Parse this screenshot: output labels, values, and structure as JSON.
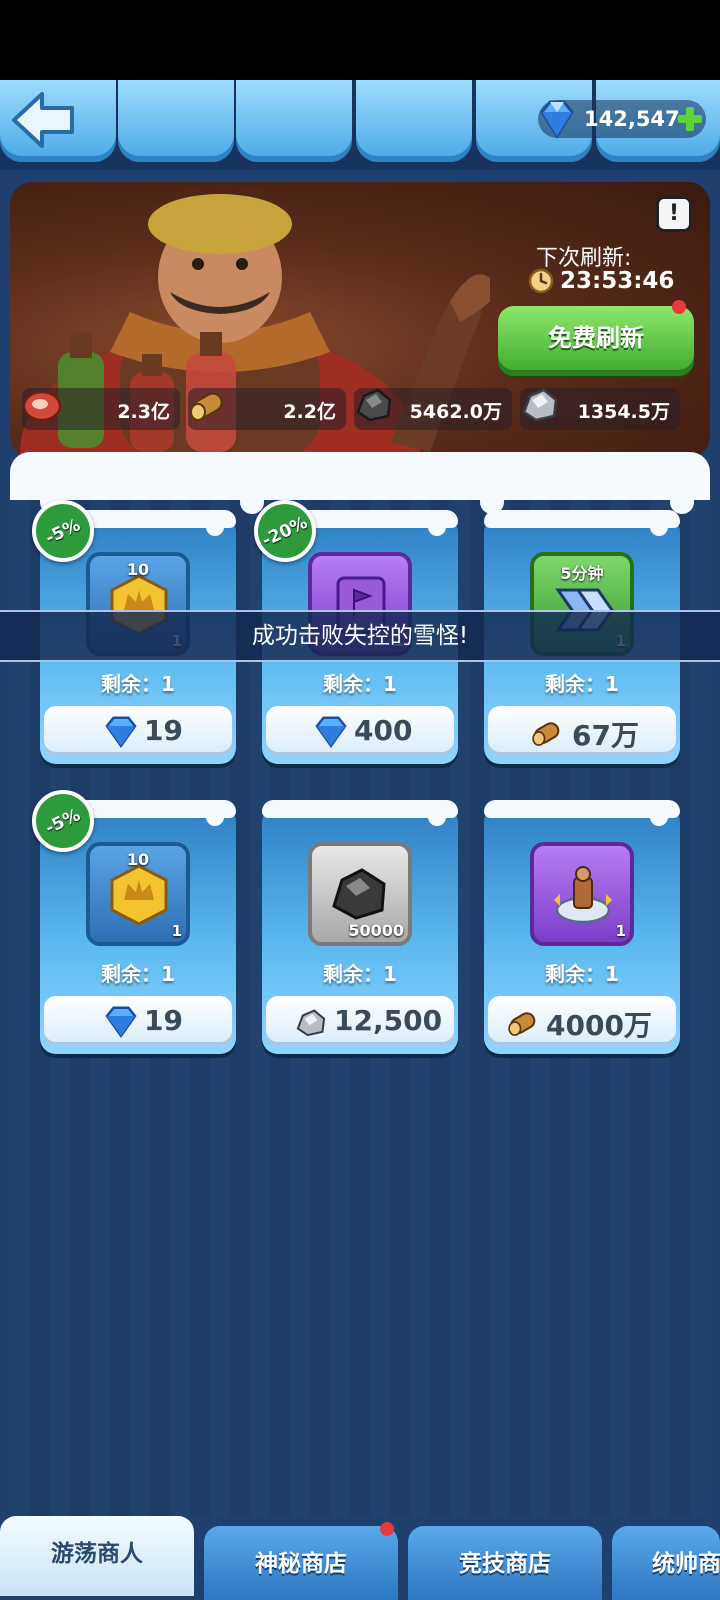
{
  "header": {
    "gems": "142,547"
  },
  "banner": {
    "next_refresh_label": "下次刷新:",
    "timer": "23:53:46",
    "free_refresh_label": "免费刷新",
    "info_glyph": "!",
    "resources": [
      {
        "icon": "meat-icon",
        "value": "2.3亿"
      },
      {
        "icon": "wood-log-icon",
        "value": "2.2亿"
      },
      {
        "icon": "coal-ore-icon",
        "value": "5462.0万"
      },
      {
        "icon": "iron-ore-icon",
        "value": "1354.5万"
      }
    ]
  },
  "toast": "成功击败失控的雪怪!",
  "items": [
    {
      "discount": "-5%",
      "top_count": "10",
      "count": "1",
      "icon": "gold-crown-badge-icon",
      "remaining": "剩余：1",
      "price_icon": "gem-icon",
      "price": "19"
    },
    {
      "discount": "-20%",
      "top_count": "",
      "count": "1",
      "icon": "purple-flag-card-icon",
      "remaining": "剩余：1",
      "price_icon": "gem-icon",
      "price": "400"
    },
    {
      "discount": "",
      "top_count": "5分钟",
      "count": "1",
      "icon": "speedup-arrows-icon",
      "remaining": "剩余：1",
      "price_icon": "wood-log-icon",
      "price": "67万"
    },
    {
      "discount": "-5%",
      "top_count": "10",
      "count": "1",
      "icon": "gold-crown-badge-icon",
      "remaining": "剩余：1",
      "price_icon": "gem-icon",
      "price": "19"
    },
    {
      "discount": "",
      "top_count": "",
      "count": "50000",
      "icon": "coal-ore-icon",
      "remaining": "剩余：1",
      "price_icon": "iron-ore-icon",
      "price": "12,500"
    },
    {
      "discount": "",
      "top_count": "",
      "count": "1",
      "icon": "hero-statue-icon",
      "remaining": "剩余：1",
      "price_icon": "wood-log-icon",
      "price": "4000万"
    }
  ],
  "tabs": [
    {
      "label": "游荡商人",
      "active": true
    },
    {
      "label": "神秘商店",
      "badge": true
    },
    {
      "label": "竞技商店"
    },
    {
      "label": "统帅商"
    }
  ],
  "colors": {
    "accent_green": "#3ba82c",
    "panel_blue": "#20426f",
    "discount_green": "#2d9a3c",
    "badge_red": "#e8383a"
  }
}
